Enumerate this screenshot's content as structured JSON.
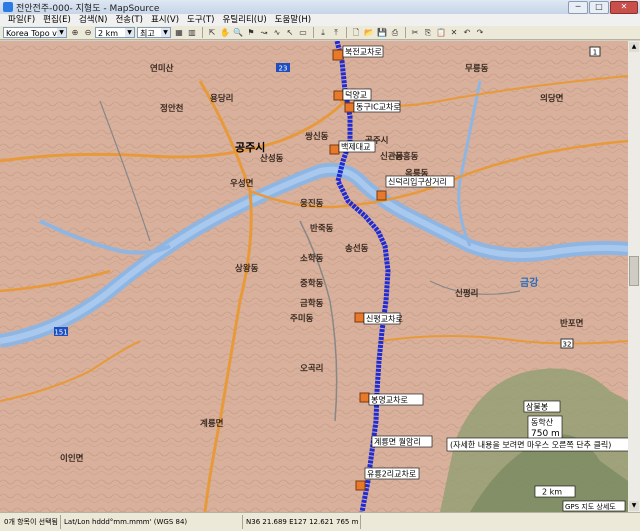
{
  "window": {
    "title": "전안전주-000- 지형도 - MapSource",
    "buttons": [
      "─",
      "□",
      "✕"
    ]
  },
  "menu": [
    "파일(F)",
    "편집(E)",
    "검색(N)",
    "전송(T)",
    "표시(V)",
    "도구(T)",
    "유틸리티(U)",
    "도움말(H)"
  ],
  "toolbar": {
    "map_product": "Korea Topo v1",
    "zoom_level": "2 km",
    "detail": "최고"
  },
  "map": {
    "route_points": [
      {
        "label": "북전교차로",
        "icon": "waypoint-icon"
      },
      {
        "label": "덕양교",
        "icon": "waypoint-icon"
      },
      {
        "label": "동구IC교차로",
        "icon": "waypoint-icon"
      },
      {
        "label": "백제대교",
        "icon": "waypoint-icon"
      },
      {
        "label": "신덕리입구삼거리",
        "icon": "waypoint-icon"
      },
      {
        "label": "신평교차로",
        "icon": "waypoint-icon"
      },
      {
        "label": "봉명교차로",
        "icon": "waypoint-icon"
      },
      {
        "label": "계룡면 월암리",
        "icon": "waypoint-icon"
      },
      {
        "label": "유룡2리교차로",
        "icon": "waypoint-icon"
      }
    ],
    "places": [
      "금강",
      "공주시",
      "계룡면",
      "이인면",
      "신관동",
      "금학동",
      "중학동",
      "산성동",
      "반죽동",
      "옥룡동",
      "용당리",
      "정안천",
      "신평리",
      "우성면",
      "쌍신동",
      "연미산",
      "금흥동",
      "소학동",
      "주미동",
      "웅진동",
      "상왕동",
      "무릉동",
      "오곡리",
      "송선동",
      "의당면",
      "반포면"
    ],
    "tooltip": {
      "name": "삼불봉",
      "type": "동학산",
      "elevation": "750 m",
      "hint": "(자세한 내용을 보려면 마우스 오른쪽 단추 클릭)"
    },
    "road_badges": [
      "1",
      "23",
      "32",
      "151"
    ],
    "scale_text": "2 km",
    "layer_hint": "GPS 지도 상세도"
  },
  "status": {
    "selection": "0개 항목이 선택됨",
    "coord_format": "Lat/Lon hddd°mm.mmm' (WGS 84)",
    "position": "N36 21.689 E127 12.621",
    "elevation": "765 m"
  },
  "colors": {
    "land": "#d8b09c",
    "river": "#8fb6e3",
    "route": "#1f2bd6",
    "road_orange": "#e89a3a",
    "mountain": "#8a9a6e"
  }
}
